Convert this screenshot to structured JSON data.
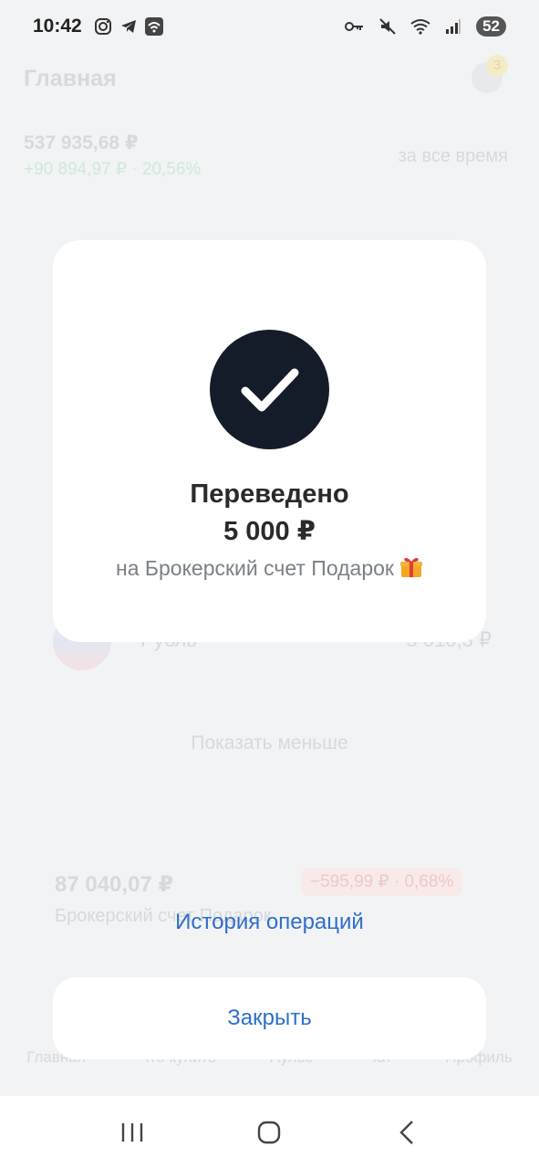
{
  "status_bar": {
    "time": "10:42",
    "battery": "52",
    "icons": [
      "instagram-icon",
      "telegram-icon",
      "wifi-box-icon",
      "key-icon",
      "mute-icon",
      "wifi-icon",
      "signal-icon"
    ]
  },
  "background_app": {
    "title": "Главная",
    "notification_count": "3",
    "portfolio_total": "537 935,68 ₽",
    "portfolio_gain": "+90 894,97 ₽ · 20,56%",
    "period": "за все время",
    "currency_row": {
      "name": "Рубль",
      "value": "5 010,3 ₽"
    },
    "show_less": "Показать меньше",
    "account": {
      "value": "87 040,07 ₽",
      "change": "−595,99 ₽ · 0,68%",
      "name": "Брокерский счет Подарок"
    },
    "nav": [
      "Главная",
      "Что купить",
      "Пульс",
      "Чат",
      "Профиль"
    ]
  },
  "dialog": {
    "title": "Переведено",
    "amount": "5 000 ₽",
    "subtitle": "на Брокерский счет Подарок"
  },
  "actions": {
    "history": "История операций",
    "close": "Закрыть"
  },
  "colors": {
    "accent": "#2f6fc8",
    "check_bg": "#141c29",
    "backdrop": "#f2f3f5"
  }
}
